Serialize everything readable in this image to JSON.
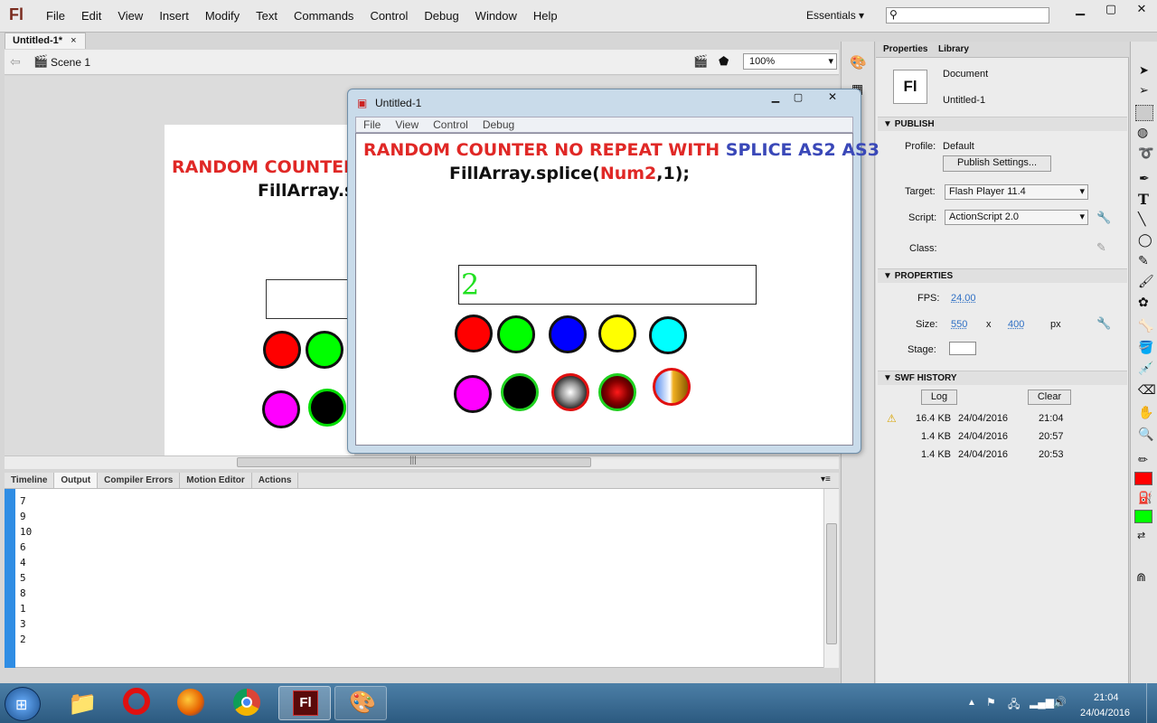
{
  "app": {
    "logo": "Fl"
  },
  "menu": [
    "File",
    "Edit",
    "View",
    "Insert",
    "Modify",
    "Text",
    "Commands",
    "Control",
    "Debug",
    "Window",
    "Help"
  ],
  "workspace": "Essentials",
  "document_tab": "Untitled-1*",
  "scene": "Scene 1",
  "zoom": "100%",
  "stage_text": {
    "title_red": "RANDOM COUNTER",
    "code": "FillArray.s"
  },
  "panel_tabs": [
    "Timeline",
    "Output",
    "Compiler Errors",
    "Motion Editor",
    "Actions"
  ],
  "output_lines": [
    "7",
    "9",
    "10",
    "6",
    "4",
    "5",
    "8",
    "1",
    "3",
    "2"
  ],
  "properties": {
    "tab_properties": "Properties",
    "tab_library": "Library",
    "doc_label": "Document",
    "doc_name": "Untitled-1",
    "publish_header": "PUBLISH",
    "profile_label": "Profile:",
    "profile_value": "Default",
    "publish_settings": "Publish Settings...",
    "target_label": "Target:",
    "target_value": "Flash Player 11.4",
    "script_label": "Script:",
    "script_value": "ActionScript 2.0",
    "class_label": "Class:",
    "properties_header": "PROPERTIES",
    "fps_label": "FPS:",
    "fps_value": "24.00",
    "size_label": "Size:",
    "width": "550",
    "x": "x",
    "height": "400",
    "px": "px",
    "stage_label": "Stage:",
    "swf_header": "SWF HISTORY",
    "log_btn": "Log",
    "clear_btn": "Clear",
    "history": [
      {
        "size": "16.4 KB",
        "date": "24/04/2016",
        "time": "21:04"
      },
      {
        "size": "1.4 KB",
        "date": "24/04/2016",
        "time": "20:57"
      },
      {
        "size": "1.4 KB",
        "date": "24/04/2016",
        "time": "20:53"
      }
    ]
  },
  "swf": {
    "title": "Untitled-1",
    "menu": [
      "File",
      "View",
      "Control",
      "Debug"
    ],
    "heading_red": "RANDOM COUNTER NO REPEAT WITH",
    "heading_blue": "SPLICE AS2 AS3",
    "code_pre": "FillArray.splice(",
    "code_var": "Num2",
    "code_post": ",1);",
    "counter": "2"
  },
  "clock": {
    "time": "21:04",
    "date": "24/04/2016"
  },
  "colors": {
    "red": "#ff0000",
    "green": "#00ff00",
    "blue": "#0000ff",
    "yellow": "#ffff00",
    "cyan": "#00ffff",
    "magenta": "#ff00ff"
  }
}
